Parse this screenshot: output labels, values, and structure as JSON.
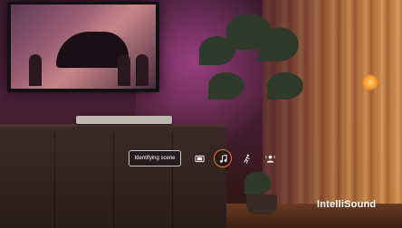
{
  "overlay": {
    "status_text": "Identifying scene"
  },
  "modes": [
    {
      "icon": "film-icon",
      "active": false
    },
    {
      "icon": "music-note-icon",
      "active": true
    },
    {
      "icon": "sports-icon",
      "active": false
    },
    {
      "icon": "voice-icon",
      "active": false
    }
  ],
  "brand": {
    "name": "IntelliSound"
  },
  "colors": {
    "accent": "#f07a1a",
    "overlay_border": "#ffffff",
    "text": "#ffffff"
  }
}
